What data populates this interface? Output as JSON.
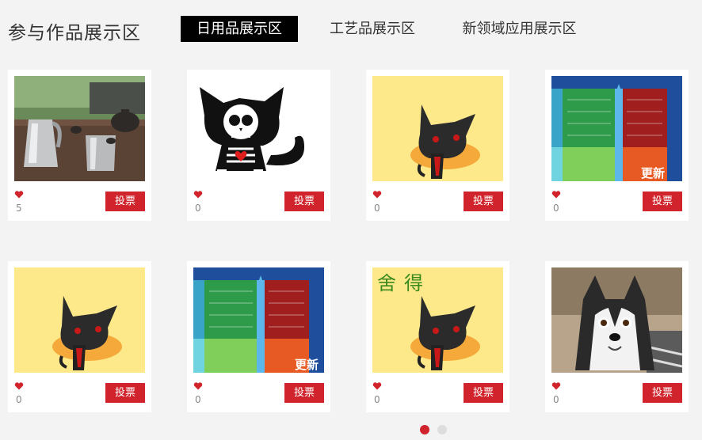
{
  "header": {
    "title": "参与作品展示区",
    "tabs": [
      {
        "label": "日用品展示区",
        "active": true
      },
      {
        "label": "工艺品展示区",
        "active": false
      },
      {
        "label": "新领域应用展示区",
        "active": false
      }
    ]
  },
  "cards": [
    {
      "image": "kettle-photo",
      "votes": "5",
      "vote_label": "投票"
    },
    {
      "image": "skeleton-cat",
      "votes": "0",
      "vote_label": "投票"
    },
    {
      "image": "black-cat-yellow",
      "votes": "0",
      "vote_label": "投票"
    },
    {
      "image": "spreadsheet-chart",
      "votes": "0",
      "vote_label": "投票"
    },
    {
      "image": "black-cat-yellow",
      "votes": "0",
      "vote_label": "投票"
    },
    {
      "image": "spreadsheet-chart",
      "votes": "0",
      "vote_label": "投票"
    },
    {
      "image": "black-cat-calligraphy",
      "votes": "0",
      "vote_label": "投票"
    },
    {
      "image": "husky-photo",
      "votes": "0",
      "vote_label": "投票"
    }
  ],
  "image_text": {
    "update_badge": "更新",
    "calligraphy": "舍得"
  },
  "pager": {
    "pages": 2,
    "current": 1
  },
  "colors": {
    "accent": "#d0232b",
    "tab_active_bg": "#000000",
    "heart": "#d0232b"
  }
}
